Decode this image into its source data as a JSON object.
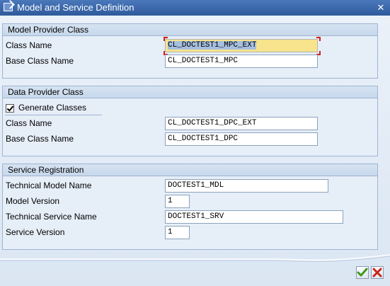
{
  "window": {
    "title": "Model and Service Definition"
  },
  "model_provider": {
    "header": "Model Provider Class",
    "class_name_label": "Class Name",
    "class_name_value": "CL_DOCTEST1_MPC_EXT",
    "base_class_label": "Base Class Name",
    "base_class_value": "CL_DOCTEST1_MPC"
  },
  "data_provider": {
    "header": "Data Provider Class",
    "generate_label": "Generate Classes",
    "generate_checked": true,
    "class_name_label": "Class Name",
    "class_name_value": "CL_DOCTEST1_DPC_EXT",
    "base_class_label": "Base Class Name",
    "base_class_value": "CL_DOCTEST1_DPC"
  },
  "service_registration": {
    "header": "Service Registration",
    "tech_model_label": "Technical Model Name",
    "tech_model_value": "DOCTEST1_MDL",
    "model_version_label": "Model Version",
    "model_version_value": "1",
    "tech_service_label": "Technical Service Name",
    "tech_service_value": "DOCTEST1_SRV",
    "service_version_label": "Service Version",
    "service_version_value": "1"
  },
  "footer": {
    "ok_icon": "checkmark-icon",
    "cancel_icon": "cancel-x-icon",
    "ok_color": "#3c9a1a",
    "cancel_color": "#c8261b"
  }
}
